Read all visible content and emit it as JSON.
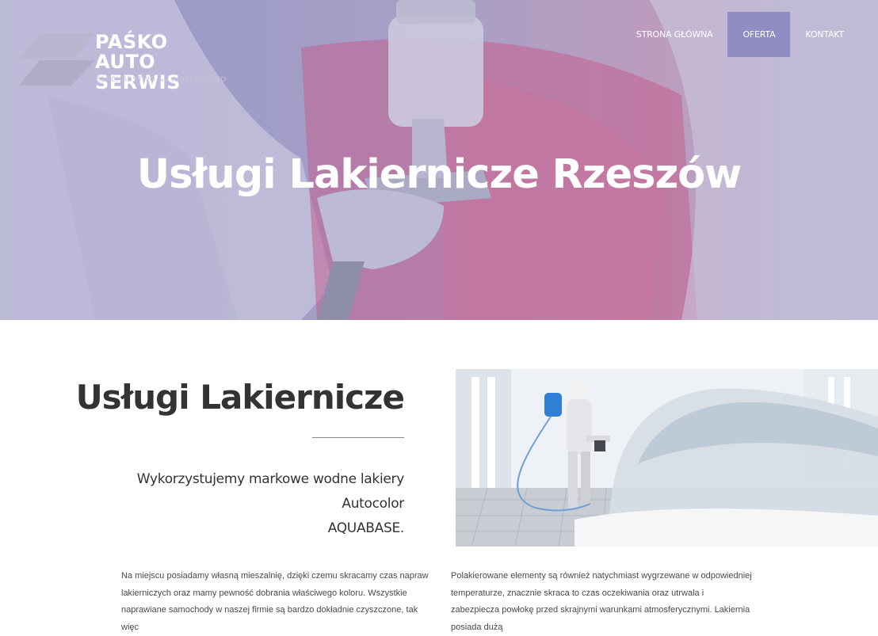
{
  "brand": {
    "line1": "PAŚKO",
    "line2": "AUTO SERWIS",
    "tagline": "BLACHARSTWO & LAKIERNICTWO"
  },
  "nav": {
    "items": [
      {
        "label": "STRONA GŁÓWNA",
        "active": false
      },
      {
        "label": "OFERTA",
        "active": true
      },
      {
        "label": "KONTAKT",
        "active": false
      }
    ]
  },
  "hero": {
    "title": "Usługi Lakiernicze Rzeszów"
  },
  "section": {
    "title": "Usługi Lakiernicze",
    "lead_line1": "Wykorzystujemy markowe wodne lakiery Autocolor",
    "lead_line2": "AQUABASE."
  },
  "body": {
    "left_paragraph": "Na miejscu posiadamy własną mieszalnię, dzięki czemu skracamy czas napraw lakierniczych oraz mamy pewność dobrania właściwego koloru. Wszystkie naprawiane samochody w naszej firmie są bardzo dokładnie czyszczone, tak więc",
    "right_paragraph": "Polakierowane elementy są również natychmiast wygrzewane w odpowiedniej temperaturze, znacznie skraca to czas oczekiwania oraz utrwala i zabezpiecza powłokę przed skrajnymi warunkami atmosferycznymi. Lakiernia posiada dużą"
  },
  "colors": {
    "hero_tint": "#9d9cc4",
    "nav_active_bg": "#8f8dc3",
    "text_dark": "#333333"
  }
}
